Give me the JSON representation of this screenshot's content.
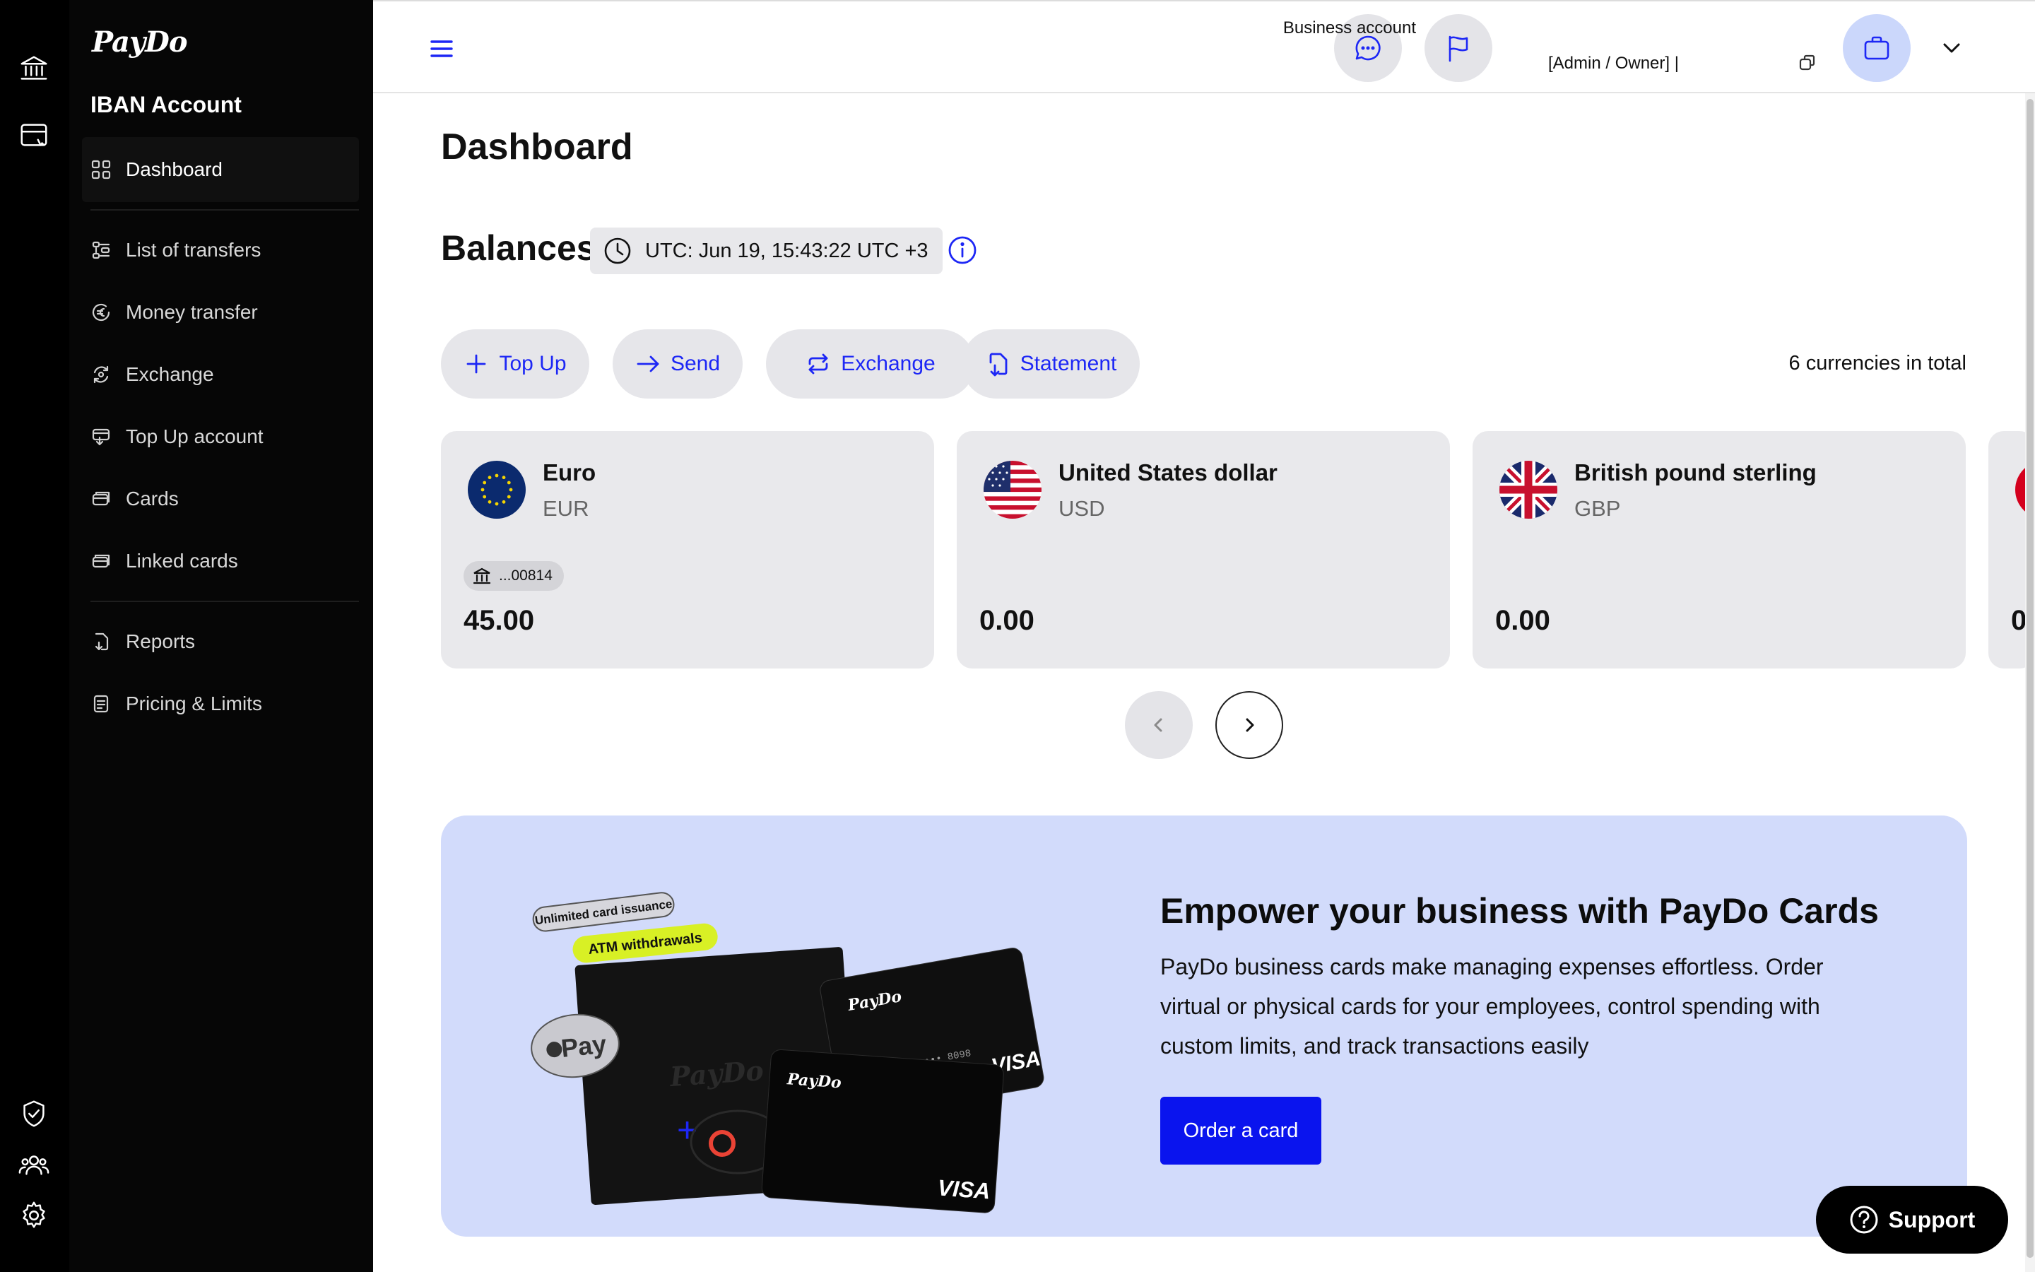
{
  "brand": {
    "logo_text": "PayDo"
  },
  "sidebar": {
    "section_title": "IBAN Account",
    "items": [
      {
        "label": "Dashboard",
        "icon": "grid-icon"
      },
      {
        "label": "List of transfers",
        "icon": "transfers-icon"
      },
      {
        "label": "Money transfer",
        "icon": "euro-circle-icon"
      },
      {
        "label": "Exchange",
        "icon": "exchange-icon"
      },
      {
        "label": "Top Up account",
        "icon": "topup-icon"
      },
      {
        "label": "Cards",
        "icon": "cards-icon"
      },
      {
        "label": "Linked cards",
        "icon": "linked-cards-icon"
      },
      {
        "label": "Reports",
        "icon": "reports-icon"
      },
      {
        "label": "Pricing & Limits",
        "icon": "pricing-icon"
      }
    ]
  },
  "header": {
    "account_type": "Business account",
    "role": "[Admin / Owner]  |"
  },
  "main": {
    "page_title": "Dashboard",
    "balances_title": "Balances",
    "utc_text": "UTC: Jun 19, 15:43:22 UTC +3",
    "actions": {
      "top_up": "Top Up",
      "send": "Send",
      "exchange": "Exchange",
      "statement": "Statement"
    },
    "currencies_total": "6 currencies in total",
    "currencies": [
      {
        "name": "Euro",
        "code": "EUR",
        "iban_suffix": "...00814",
        "amount": "45.00"
      },
      {
        "name": "United States dollar",
        "code": "USD",
        "amount": "0.00"
      },
      {
        "name": "British pound sterling",
        "code": "GBP",
        "amount": "0.00"
      },
      {
        "amount": "0"
      }
    ]
  },
  "promo": {
    "tag_1": "Unlimited card issuance",
    "tag_2": "ATM withdrawals",
    "apple_pay": "Pay",
    "card_brand": "VISA",
    "card_number": "5225 68•• •••• 8098",
    "heading": "Empower your business with PayDo Cards",
    "body": "PayDo business cards make managing expenses effortless. Order virtual or physical cards for your employees, control spending with custom limits, and track transactions easily",
    "button": "Order a card"
  },
  "support": {
    "label": "Support"
  },
  "colors": {
    "accent": "#1d27f5",
    "button_blue": "#0a14ee",
    "sidebar_bg": "#060606",
    "card_bg": "#e9e9ec",
    "promo_bg": "#d2dbfb",
    "tag_green": "#d8f025"
  }
}
